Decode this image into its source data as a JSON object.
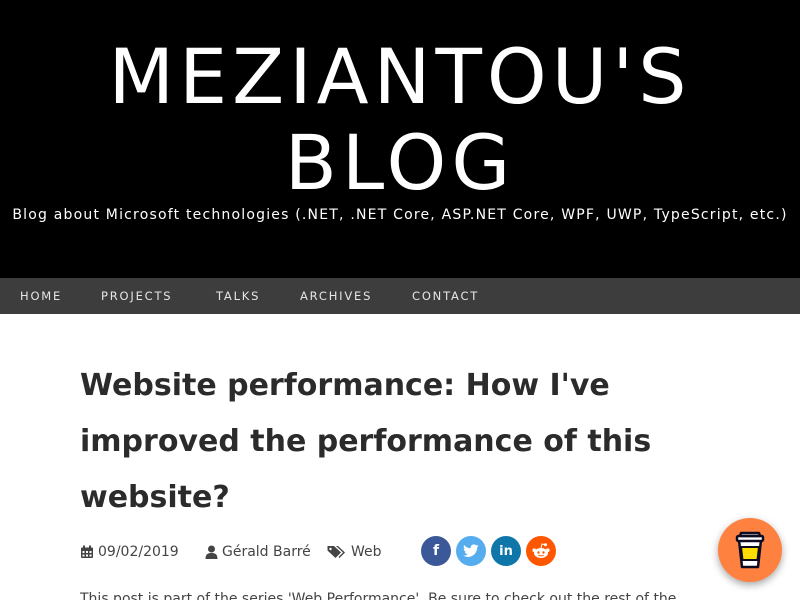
{
  "header": {
    "title_line1": "MEZIANTOU'S",
    "title_line2": "BLOG",
    "tagline": "Blog about Microsoft technologies (.NET, .NET Core, ASP.NET Core, WPF, UWP, TypeScript, etc.)"
  },
  "nav": {
    "items": [
      {
        "label": "HOME"
      },
      {
        "label": "PROJECTS"
      },
      {
        "label": "TALKS"
      },
      {
        "label": "ARCHIVES"
      },
      {
        "label": "CONTACT"
      }
    ]
  },
  "post": {
    "title": "Website performance: How I've improved the performance of this website?",
    "date": "09/02/2019",
    "author": "Gérald Barré",
    "tag": "Web",
    "intro": "This post is part of the series 'Web Performance'. Be sure to check out the rest of the"
  },
  "share": {
    "facebook": {
      "glyph": "f",
      "color": "#3b5998",
      "icon": "facebook-icon"
    },
    "twitter": {
      "color": "#55acee",
      "icon": "twitter-icon"
    },
    "linkedin": {
      "glyph": "in",
      "color": "#0e76a8",
      "icon": "linkedin-icon"
    },
    "reddit": {
      "color": "#ff5700",
      "icon": "reddit-icon"
    }
  },
  "colors": {
    "header_bg": "#000000",
    "nav_bg": "#3d3d3d",
    "coffee_orange": "#ff813f"
  }
}
